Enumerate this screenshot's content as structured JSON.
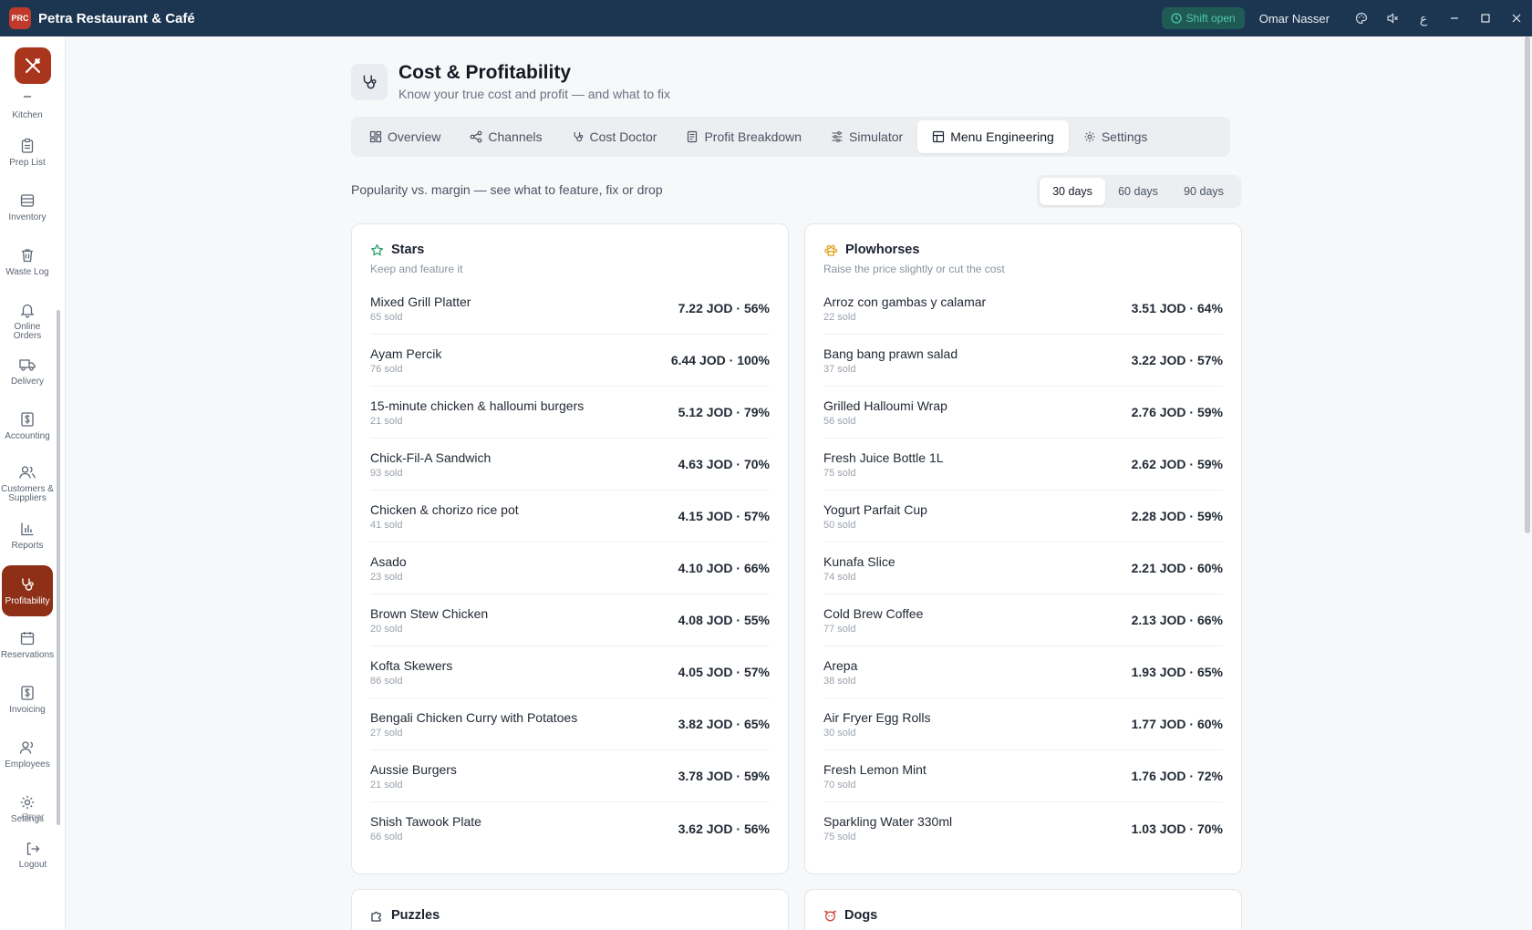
{
  "window": {
    "app_title": "Petra Restaurant & Café",
    "logo_text": "PRC",
    "shift_status": "Shift open",
    "user_name": "Omar Nasser"
  },
  "sidebar": {
    "items": [
      {
        "label": "Kitchen",
        "icon": "kitchen-icon"
      },
      {
        "label": "Prep List",
        "icon": "clipboard-icon"
      },
      {
        "label": "Inventory",
        "icon": "inventory-icon"
      },
      {
        "label": "Waste Log",
        "icon": "trash-icon"
      },
      {
        "label": "Online Orders",
        "icon": "bell-icon"
      },
      {
        "label": "Delivery",
        "icon": "truck-icon"
      },
      {
        "label": "Accounting",
        "icon": "dollar-icon"
      },
      {
        "label": "Customers & Suppliers",
        "icon": "users-icon"
      },
      {
        "label": "Reports",
        "icon": "bar-chart-icon"
      },
      {
        "label": "Profitability",
        "icon": "stethoscope-icon"
      },
      {
        "label": "Reservations",
        "icon": "calendar-icon"
      },
      {
        "label": "Invoicing",
        "icon": "invoice-icon"
      },
      {
        "label": "Employees",
        "icon": "employees-icon"
      },
      {
        "label": "Settings",
        "icon": "gear-icon"
      }
    ],
    "user_short": "Omar",
    "logout_label": "Logout"
  },
  "page": {
    "title": "Cost & Profitability",
    "subtitle": "Know your true cost and profit — and what to fix"
  },
  "tabs": [
    {
      "label": "Overview",
      "icon": "grid-icon"
    },
    {
      "label": "Channels",
      "icon": "share-icon"
    },
    {
      "label": "Cost Doctor",
      "icon": "stethoscope-icon"
    },
    {
      "label": "Profit Breakdown",
      "icon": "receipt-icon"
    },
    {
      "label": "Simulator",
      "icon": "sliders-icon"
    },
    {
      "label": "Menu Engineering",
      "icon": "table-icon",
      "active": true
    },
    {
      "label": "Settings",
      "icon": "gear-icon"
    }
  ],
  "menu_engineering": {
    "caption": "Popularity vs. margin — see what to feature, fix or drop",
    "periods": [
      "30 days",
      "60 days",
      "90 days"
    ],
    "selected_period": "30 days",
    "stars": {
      "title": "Stars",
      "subtitle": "Keep and feature it",
      "items": [
        {
          "name": "Mixed Grill Platter",
          "sold": "65 sold",
          "value": "7.22 JOD · 56%"
        },
        {
          "name": "Ayam Percik",
          "sold": "76 sold",
          "value": "6.44 JOD · 100%"
        },
        {
          "name": "15-minute chicken & halloumi burgers",
          "sold": "21 sold",
          "value": "5.12 JOD · 79%"
        },
        {
          "name": "Chick-Fil-A Sandwich",
          "sold": "93 sold",
          "value": "4.63 JOD · 70%"
        },
        {
          "name": "Chicken & chorizo rice pot",
          "sold": "41 sold",
          "value": "4.15 JOD · 57%"
        },
        {
          "name": "Asado",
          "sold": "23 sold",
          "value": "4.10 JOD · 66%"
        },
        {
          "name": "Brown Stew Chicken",
          "sold": "20 sold",
          "value": "4.08 JOD · 55%"
        },
        {
          "name": "Kofta Skewers",
          "sold": "86 sold",
          "value": "4.05 JOD · 57%"
        },
        {
          "name": "Bengali Chicken Curry with Potatoes",
          "sold": "27 sold",
          "value": "3.82 JOD · 65%"
        },
        {
          "name": "Aussie Burgers",
          "sold": "21 sold",
          "value": "3.78 JOD · 59%"
        },
        {
          "name": "Shish Tawook Plate",
          "sold": "66 sold",
          "value": "3.62 JOD · 56%"
        }
      ]
    },
    "plowhorses": {
      "title": "Plowhorses",
      "subtitle": "Raise the price slightly or cut the cost",
      "items": [
        {
          "name": "Arroz con gambas y calamar",
          "sold": "22 sold",
          "value": "3.51 JOD · 64%"
        },
        {
          "name": "Bang bang prawn salad",
          "sold": "37 sold",
          "value": "3.22 JOD · 57%"
        },
        {
          "name": "Grilled Halloumi Wrap",
          "sold": "56 sold",
          "value": "2.76 JOD · 59%"
        },
        {
          "name": "Fresh Juice Bottle 1L",
          "sold": "75 sold",
          "value": "2.62 JOD · 59%"
        },
        {
          "name": "Yogurt Parfait Cup",
          "sold": "50 sold",
          "value": "2.28 JOD · 59%"
        },
        {
          "name": "Kunafa Slice",
          "sold": "74 sold",
          "value": "2.21 JOD · 60%"
        },
        {
          "name": "Cold Brew Coffee",
          "sold": "77 sold",
          "value": "2.13 JOD · 66%"
        },
        {
          "name": "Arepa",
          "sold": "38 sold",
          "value": "1.93 JOD · 65%"
        },
        {
          "name": "Air Fryer Egg Rolls",
          "sold": "30 sold",
          "value": "1.77 JOD · 60%"
        },
        {
          "name": "Fresh Lemon Mint",
          "sold": "70 sold",
          "value": "1.76 JOD · 72%"
        },
        {
          "name": "Sparkling Water 330ml",
          "sold": "75 sold",
          "value": "1.03 JOD · 70%"
        }
      ]
    },
    "puzzles": {
      "title": "Puzzles"
    },
    "dogs": {
      "title": "Dogs"
    }
  },
  "colors": {
    "titlebar": "#1c3550",
    "brand": "#a9361c",
    "active_nav": "#8e2f17",
    "star_icon": "#2fa36b",
    "plowhorse_icon": "#e0a21b",
    "puzzle_icon": "#3b4452",
    "dog_icon": "#d2453d"
  }
}
